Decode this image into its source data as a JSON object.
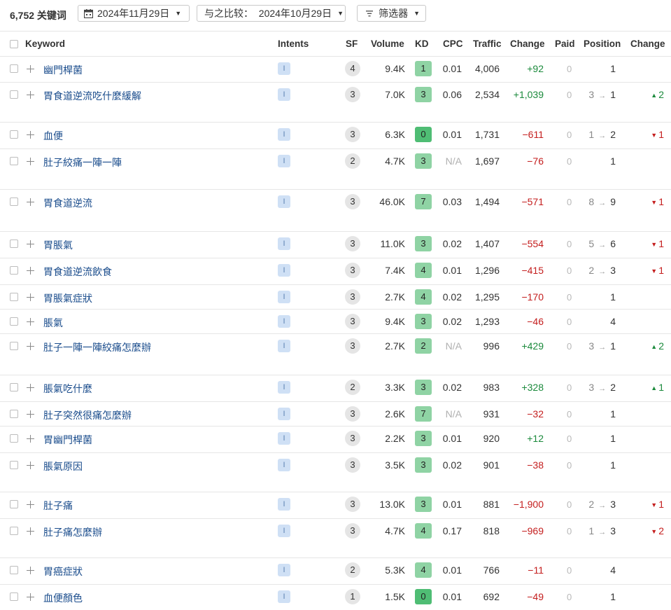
{
  "toolbar": {
    "count": "6,752 关键词",
    "date_label": "2024年11月29日",
    "compare_label": "与之比较：  2024年10月29日",
    "filter_label": "筛选器"
  },
  "columns": {
    "keyword": "Keyword",
    "intents": "Intents",
    "sf": "SF",
    "volume": "Volume",
    "kd": "KD",
    "cpc": "CPC",
    "traffic": "Traffic",
    "change": "Change",
    "paid": "Paid",
    "position": "Position",
    "change2": "Change"
  },
  "colors": {
    "kd_light": "#8fd3a4",
    "kd_easy": "#4fbd74",
    "positive": "#1b8a3c",
    "negative": "#c41e1e",
    "keyword": "#1a4c8c"
  },
  "rows": [
    {
      "keyword": "幽門桿菌",
      "intent": "I",
      "sf": "4",
      "volume": "9.4K",
      "kd": "1",
      "cpc": "0.01",
      "traffic": "4,006",
      "change": "+92",
      "paid": "0",
      "pos_prev": "",
      "pos": "1",
      "pos_change": "",
      "dir": ""
    },
    {
      "keyword": "胃食道逆流吃什麼緩解",
      "intent": "I",
      "sf": "3",
      "volume": "7.0K",
      "kd": "3",
      "cpc": "0.06",
      "traffic": "2,534",
      "change": "+1,039",
      "paid": "0",
      "pos_prev": "3",
      "pos": "1",
      "pos_change": "2",
      "dir": "up"
    },
    {
      "keyword": "血便",
      "intent": "I",
      "sf": "3",
      "volume": "6.3K",
      "kd": "0",
      "cpc": "0.01",
      "traffic": "1,731",
      "change": "−611",
      "paid": "0",
      "pos_prev": "1",
      "pos": "2",
      "pos_change": "1",
      "dir": "down"
    },
    {
      "keyword": "肚子絞痛一陣一陣",
      "intent": "I",
      "sf": "2",
      "volume": "4.7K",
      "kd": "3",
      "cpc": "N/A",
      "traffic": "1,697",
      "change": "−76",
      "paid": "0",
      "pos_prev": "",
      "pos": "1",
      "pos_change": "",
      "dir": ""
    },
    {
      "keyword": "胃食道逆流",
      "intent": "I",
      "sf": "3",
      "volume": "46.0K",
      "kd": "7",
      "cpc": "0.03",
      "traffic": "1,494",
      "change": "−571",
      "paid": "0",
      "pos_prev": "8",
      "pos": "9",
      "pos_change": "1",
      "dir": "down"
    },
    {
      "keyword": "胃脹氣",
      "intent": "I",
      "sf": "3",
      "volume": "11.0K",
      "kd": "3",
      "cpc": "0.02",
      "traffic": "1,407",
      "change": "−554",
      "paid": "0",
      "pos_prev": "5",
      "pos": "6",
      "pos_change": "1",
      "dir": "down"
    },
    {
      "keyword": "胃食道逆流飲食",
      "intent": "I",
      "sf": "3",
      "volume": "7.4K",
      "kd": "4",
      "cpc": "0.01",
      "traffic": "1,296",
      "change": "−415",
      "paid": "0",
      "pos_prev": "2",
      "pos": "3",
      "pos_change": "1",
      "dir": "down"
    },
    {
      "keyword": "胃脹氣症狀",
      "intent": "I",
      "sf": "3",
      "volume": "2.7K",
      "kd": "4",
      "cpc": "0.02",
      "traffic": "1,295",
      "change": "−170",
      "paid": "0",
      "pos_prev": "",
      "pos": "1",
      "pos_change": "",
      "dir": ""
    },
    {
      "keyword": "脹氣",
      "intent": "I",
      "sf": "3",
      "volume": "9.4K",
      "kd": "3",
      "cpc": "0.02",
      "traffic": "1,293",
      "change": "−46",
      "paid": "0",
      "pos_prev": "",
      "pos": "4",
      "pos_change": "",
      "dir": ""
    },
    {
      "keyword": "肚子一陣一陣絞痛怎麼辦",
      "intent": "I",
      "sf": "3",
      "volume": "2.7K",
      "kd": "2",
      "cpc": "N/A",
      "traffic": "996",
      "change": "+429",
      "paid": "0",
      "pos_prev": "3",
      "pos": "1",
      "pos_change": "2",
      "dir": "up"
    },
    {
      "keyword": "脹氣吃什麼",
      "intent": "I",
      "sf": "2",
      "volume": "3.3K",
      "kd": "3",
      "cpc": "0.02",
      "traffic": "983",
      "change": "+328",
      "paid": "0",
      "pos_prev": "3",
      "pos": "2",
      "pos_change": "1",
      "dir": "up"
    },
    {
      "keyword": "肚子突然很痛怎麼辦",
      "intent": "I",
      "sf": "3",
      "volume": "2.6K",
      "kd": "7",
      "cpc": "N/A",
      "traffic": "931",
      "change": "−32",
      "paid": "0",
      "pos_prev": "",
      "pos": "1",
      "pos_change": "",
      "dir": ""
    },
    {
      "keyword": "胃幽門桿菌",
      "intent": "I",
      "sf": "3",
      "volume": "2.2K",
      "kd": "3",
      "cpc": "0.01",
      "traffic": "920",
      "change": "+12",
      "paid": "0",
      "pos_prev": "",
      "pos": "1",
      "pos_change": "",
      "dir": ""
    },
    {
      "keyword": "脹氣原因",
      "intent": "I",
      "sf": "3",
      "volume": "3.5K",
      "kd": "3",
      "cpc": "0.02",
      "traffic": "901",
      "change": "−38",
      "paid": "0",
      "pos_prev": "",
      "pos": "1",
      "pos_change": "",
      "dir": ""
    },
    {
      "keyword": "肚子痛",
      "intent": "I",
      "sf": "3",
      "volume": "13.0K",
      "kd": "3",
      "cpc": "0.01",
      "traffic": "881",
      "change": "−1,900",
      "paid": "0",
      "pos_prev": "2",
      "pos": "3",
      "pos_change": "1",
      "dir": "down"
    },
    {
      "keyword": "肚子痛怎麼辦",
      "intent": "I",
      "sf": "3",
      "volume": "4.7K",
      "kd": "4",
      "cpc": "0.17",
      "traffic": "818",
      "change": "−969",
      "paid": "0",
      "pos_prev": "1",
      "pos": "3",
      "pos_change": "2",
      "dir": "down"
    },
    {
      "keyword": "胃癌症狀",
      "intent": "I",
      "sf": "2",
      "volume": "5.3K",
      "kd": "4",
      "cpc": "0.01",
      "traffic": "766",
      "change": "−11",
      "paid": "0",
      "pos_prev": "",
      "pos": "4",
      "pos_change": "",
      "dir": ""
    },
    {
      "keyword": "血便顏色",
      "intent": "I",
      "sf": "1",
      "volume": "1.5K",
      "kd": "0",
      "cpc": "0.01",
      "traffic": "692",
      "change": "−49",
      "paid": "0",
      "pos_prev": "",
      "pos": "1",
      "pos_change": "",
      "dir": ""
    }
  ]
}
